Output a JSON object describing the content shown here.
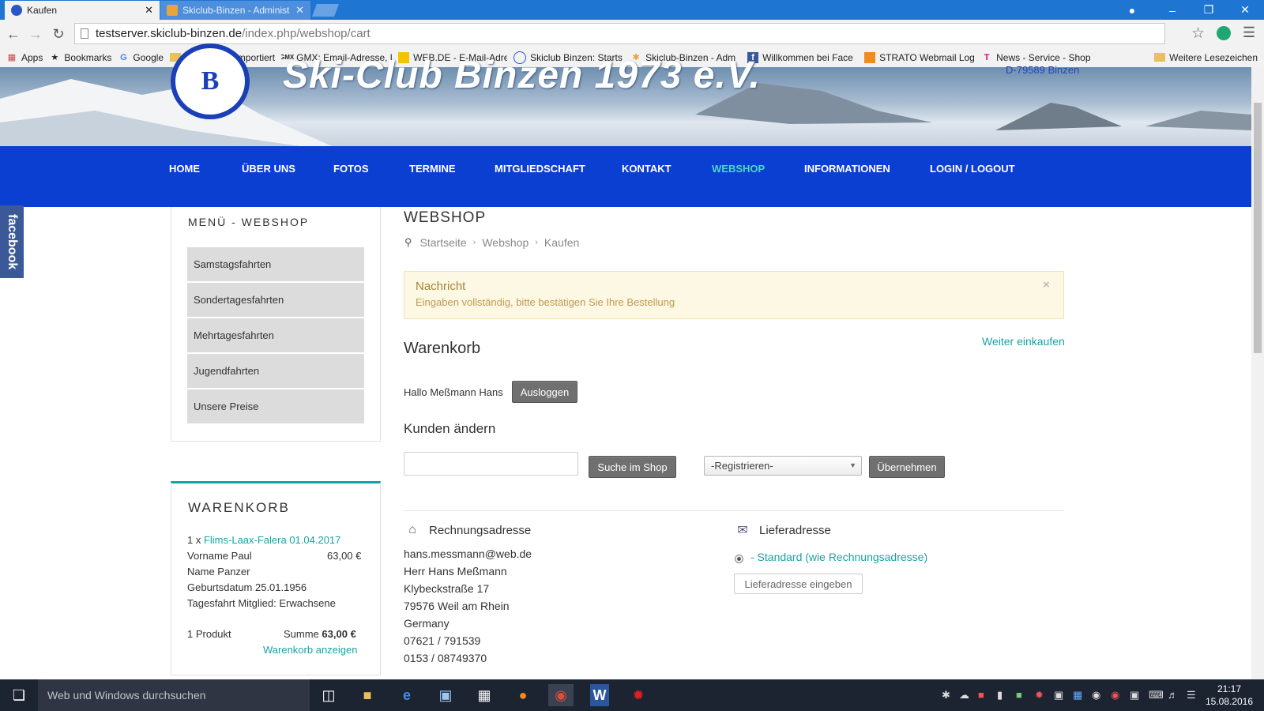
{
  "browser": {
    "tabs": [
      {
        "label": "Kaufen",
        "active": true
      },
      {
        "label": "Skiclub-Binzen - Administ",
        "active": false
      }
    ],
    "url_host": "testserver.skiclub-binzen.de",
    "url_path": "/index.php/webshop/cart",
    "bookmarks": [
      {
        "label": "Apps",
        "icon": "apps-grid-icon"
      },
      {
        "label": "Bookmarks",
        "icon": "star-icon"
      },
      {
        "label": "Google",
        "icon": "google-icon"
      },
      {
        "label": "Aus Firefox importiert",
        "icon": "folder-icon"
      },
      {
        "label": "GMX: Email-Adresse, l",
        "icon": "gmx-icon"
      },
      {
        "label": "WEB.DE - E-Mail-Adre",
        "icon": "webde-icon"
      },
      {
        "label": "Skiclub Binzen: Starts",
        "icon": "skiclub-icon"
      },
      {
        "label": "Skiclub-Binzen - Adm",
        "icon": "joomla-icon"
      },
      {
        "label": "Willkommen bei Face",
        "icon": "facebook-icon"
      },
      {
        "label": "STRATO Webmail Log",
        "icon": "strato-icon"
      },
      {
        "label": "News - Service - Shop",
        "icon": "telekom-icon"
      }
    ],
    "other_bookmarks": "Weitere Lesezeichen"
  },
  "site": {
    "title": "Ski-Club Binzen 1973 e.V.",
    "address": "D-79589 Binzen",
    "logo_letter": "B",
    "facebook_tab": "facebook"
  },
  "nav": {
    "items": [
      "HOME",
      "ÜBER UNS",
      "FOTOS",
      "TERMINE",
      "MITGLIEDSCHAFT",
      "KONTAKT",
      "WEBSHOP",
      "INFORMATIONEN",
      "LOGIN / LOGOUT"
    ],
    "active": "WEBSHOP"
  },
  "sidebar": {
    "menu_title": "MENÜ - WEBSHOP",
    "items": [
      "Samstagsfahrten",
      "Sondertagesfahrten",
      "Mehrtagesfahrten",
      "Jugendfahrten",
      "Unsere Preise"
    ],
    "cart": {
      "title": "WARENKORB",
      "qty_prefix": "1 x",
      "product": "Flims-Laax-Falera 01.04.2017",
      "first_name": "Vorname Paul",
      "price": "63,00 €",
      "last_name": "Name Panzer",
      "birthdate": "Geburtsdatum 25.01.1956",
      "type": "Tagesfahrt Mitglied: Erwachsene",
      "count": "1 Produkt",
      "sum_label": "Summe",
      "sum_value": "63,00 €",
      "show_cart": "Warenkorb anzeigen"
    }
  },
  "main": {
    "title": "WEBSHOP",
    "breadcrumb": [
      "Startseite",
      "Webshop",
      "Kaufen"
    ],
    "message": {
      "title": "Nachricht",
      "text": "Eingaben vollständig, bitte bestätigen Sie Ihre Bestellung",
      "close": "×"
    },
    "cart_heading": "Warenkorb",
    "continue_shopping": "Weiter einkaufen",
    "hello": "Hallo Meßmann Hans",
    "logout_button": "Ausloggen",
    "change_customer": "Kunden ändern",
    "search_value": "",
    "search_button": "Suche im Shop",
    "register_select": "-Registrieren-",
    "apply_button": "Übernehmen",
    "billing": {
      "heading": "Rechnungsadresse",
      "lines": [
        "hans.messmann@web.de",
        "Herr Hans Meßmann",
        "Klybeckstraße 17",
        "79576 Weil am Rhein",
        "Germany",
        "07621 / 791539",
        "0153 / 08749370"
      ]
    },
    "delivery": {
      "heading": "Lieferadresse",
      "standard": "- Standard (wie Rechnungsadresse)",
      "enter_button": "Lieferadresse eingeben"
    }
  },
  "taskbar": {
    "search_placeholder": "Web und Windows durchsuchen",
    "time": "21:17",
    "date": "15.08.2016"
  },
  "colors": {
    "nav_blue": "#0b3fd1",
    "accent_teal": "#19a3a0",
    "message_bg": "#fcf8e3"
  }
}
